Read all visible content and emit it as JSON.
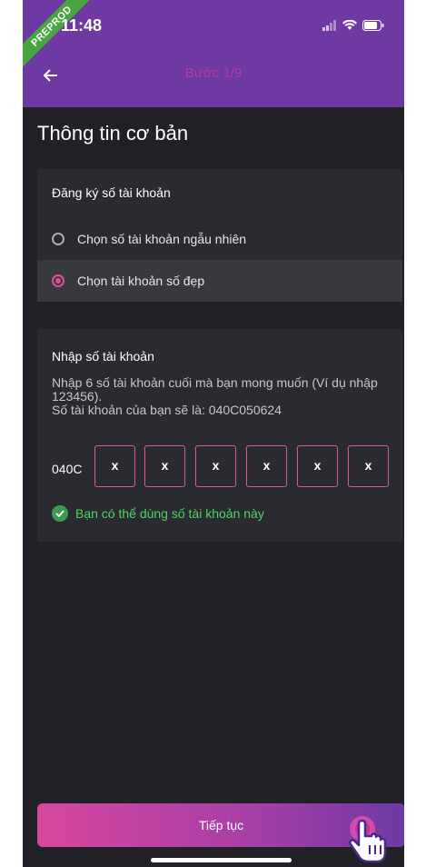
{
  "status_bar": {
    "time": "11:48",
    "badge": "PREPROD"
  },
  "header": {
    "step": "Bước 1/9"
  },
  "page": {
    "title": "Thông tin cơ bản"
  },
  "account_type": {
    "title": "Đăng ký số tài khoản",
    "options": [
      {
        "label": "Chọn số tài khoản ngẫu nhiên",
        "selected": false
      },
      {
        "label": "Chọn tài khoản số đẹp",
        "selected": true
      }
    ]
  },
  "account_number": {
    "title": "Nhập số tài khoản",
    "description": "Nhập 6 số tài khoản cuối mà bạn mong muốn (Ví dụ nhập 123456).",
    "preview": "Số tài khoản của bạn sẽ là: 040C050624",
    "prefix": "040C",
    "digits": [
      "x",
      "x",
      "x",
      "x",
      "x",
      "x"
    ],
    "valid_message": "Bạn có thể dùng số tài khoản này"
  },
  "footer": {
    "continue_label": "Tiếp tục"
  },
  "colors": {
    "header_bg": "#6e39a3",
    "accent_pink": "#e84b9c",
    "success_green": "#4cd65f",
    "screen_bg": "#212127"
  },
  "icons": [
    "back-arrow-icon",
    "signal-icon",
    "wifi-icon",
    "battery-icon",
    "check-icon",
    "pointer-hand-icon"
  ]
}
